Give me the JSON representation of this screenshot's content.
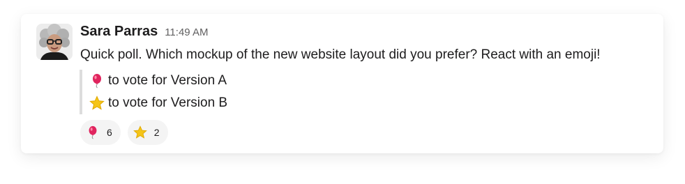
{
  "message": {
    "author": "Sara Parras",
    "timestamp": "11:49 AM",
    "text": "Quick poll. Which mockup of the new website layout did you prefer? React with an emoji!",
    "quote_lines": [
      {
        "emoji": "balloon-icon",
        "text": "to vote for Version A"
      },
      {
        "emoji": "star-icon",
        "text": "to vote for Version B"
      }
    ]
  },
  "reactions": [
    {
      "emoji": "balloon-icon",
      "count": "6"
    },
    {
      "emoji": "star-icon",
      "count": "2"
    }
  ],
  "colors": {
    "quote_bar": "#dddddd",
    "reaction_bg": "#f4f4f4",
    "balloon": "#e0245e",
    "star": "#f5c518"
  }
}
